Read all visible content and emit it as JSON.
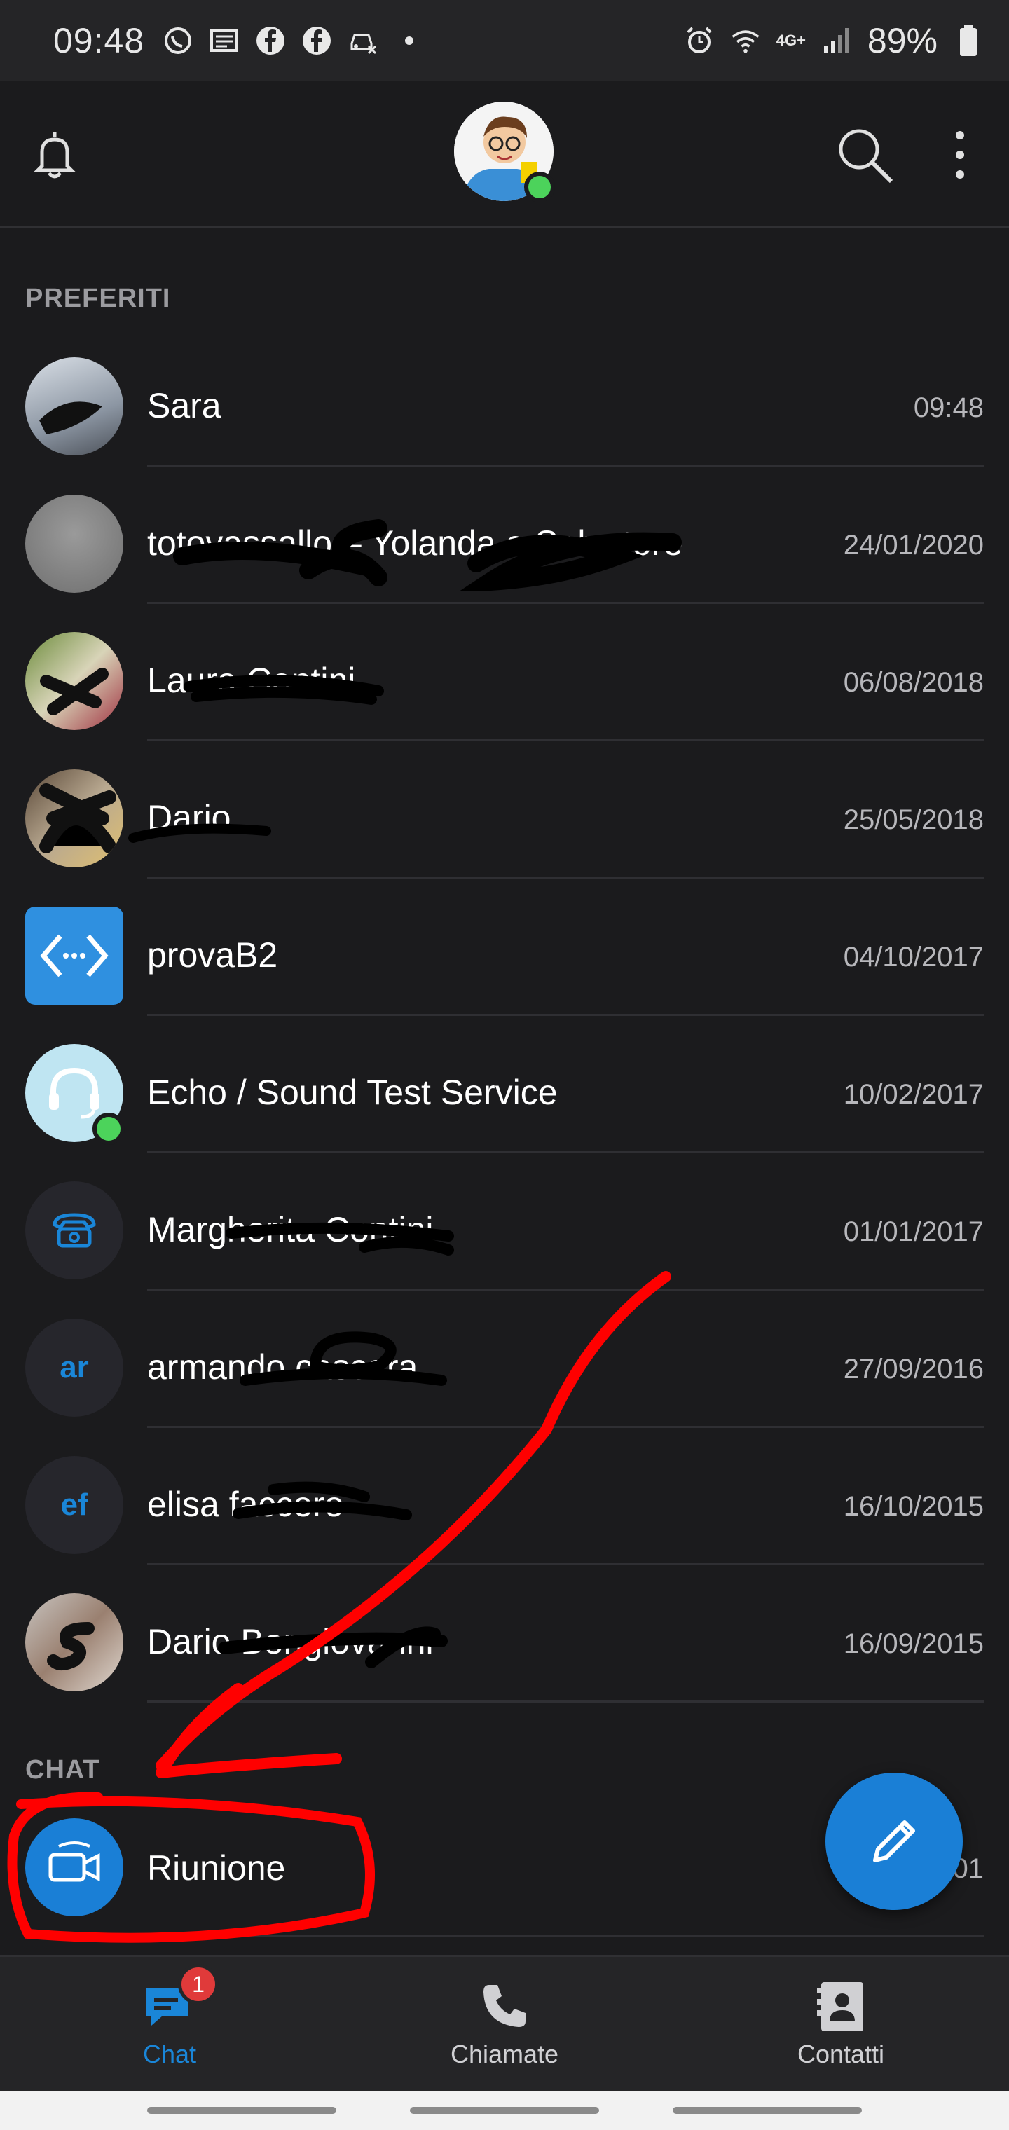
{
  "status_bar": {
    "time": "09:48",
    "battery": "89%",
    "network": "4G+",
    "notification_icons": [
      "whatsapp-icon",
      "news-icon",
      "facebook-icon",
      "facebook-icon",
      "car-icon"
    ]
  },
  "app_bar": {
    "icons": [
      "bell-icon",
      "profile-avatar",
      "search-icon",
      "more-icon"
    ]
  },
  "sections": {
    "favorites_label": "PREFERITI",
    "chat_label": "CHAT"
  },
  "favorites": [
    {
      "name": "Sara",
      "date": "09:48"
    },
    {
      "name": "totovassallo – Yolanda e Salvatore",
      "date": "24/01/2020"
    },
    {
      "name": "Laura Contini",
      "date": "06/08/2018"
    },
    {
      "name": "Dario",
      "date": "25/05/2018"
    },
    {
      "name": "provaB2",
      "date": "04/10/2017"
    },
    {
      "name": "Echo / Sound Test Service",
      "date": "10/02/2017"
    },
    {
      "name": "Margherita Contini",
      "date": "01/01/2017"
    },
    {
      "name": "armando cascara",
      "date": "27/09/2016",
      "initials": "ar"
    },
    {
      "name": "elisa faccero",
      "date": "16/10/2015",
      "initials": "ef"
    },
    {
      "name": "Dario Bongiovanni",
      "date": "16/09/2015"
    }
  ],
  "chats": [
    {
      "name": "Riunione",
      "date": "01"
    }
  ],
  "bottom_nav": [
    {
      "label": "Chat",
      "badge": "1",
      "active": true
    },
    {
      "label": "Chiamate"
    },
    {
      "label": "Contatti"
    }
  ],
  "colors": {
    "accent": "#1a86d8",
    "background": "#1b1b1d",
    "annotation": "#ff0000",
    "presence": "#4cd35b"
  }
}
